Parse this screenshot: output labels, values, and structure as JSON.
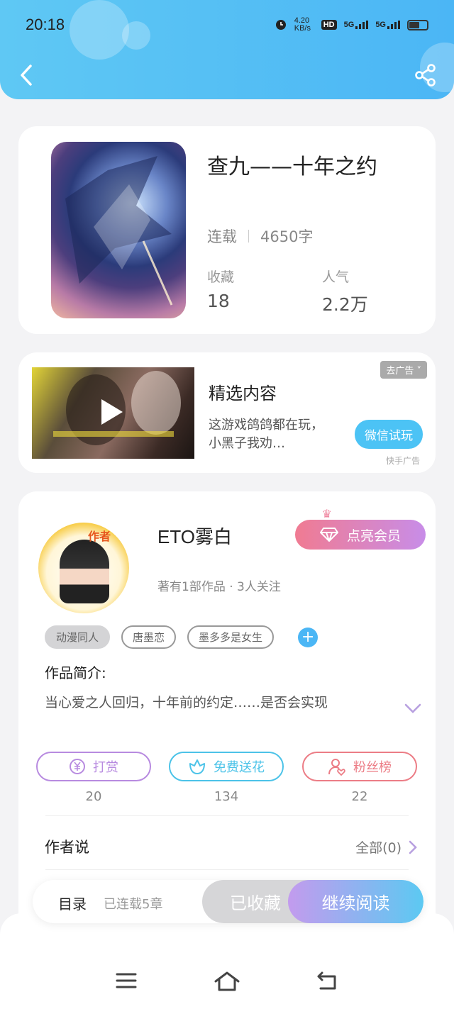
{
  "status_bar": {
    "time": "20:18",
    "net_speed": "4.20 KB/s",
    "hd": "HD",
    "signal1": "5G",
    "signal2": "5G"
  },
  "book": {
    "title": "查九——十年之约",
    "status": "连载",
    "word_count": "4650字",
    "favorites_label": "收藏",
    "favorites_value": "18",
    "popularity_label": "人气",
    "popularity_value": "2.2万"
  },
  "ad": {
    "title": "精选内容",
    "description": "这游戏鸽鸽都在玩，小黑子我劝…",
    "remove_label": "去广告 ˅",
    "cta_label": "微信试玩",
    "source": "快手广告"
  },
  "author": {
    "avatar_tag": "作者",
    "name": "ETO雾白",
    "vip_label": "点亮会员",
    "meta": "著有1部作品 · 3人关注",
    "tags": [
      "动漫同人",
      "唐墨恋",
      "墨多多是女生"
    ],
    "add_tag": "+",
    "intro_title": "作品简介:",
    "intro_text": "当心爱之人回归，十年前的约定……是否会实现"
  },
  "actions": [
    {
      "label": "打赏",
      "count": "20",
      "color": "#b88be0"
    },
    {
      "label": "免费送花",
      "count": "134",
      "color": "#4cc3e8"
    },
    {
      "label": "粉丝榜",
      "count": "22",
      "color": "#ec7d86"
    }
  ],
  "author_says": {
    "title": "作者说",
    "all_label": "全部(0)"
  },
  "read_bar": {
    "toc_label": "目录",
    "chapter_count": "已连载5章",
    "favorited_label": "已收藏",
    "continue_label": "继续阅读"
  },
  "colors": {
    "header": "#4bb6f5",
    "accent_blue": "#4bb6f5",
    "vip_pink": "#f07b92",
    "vip_purple": "#c88de8"
  }
}
